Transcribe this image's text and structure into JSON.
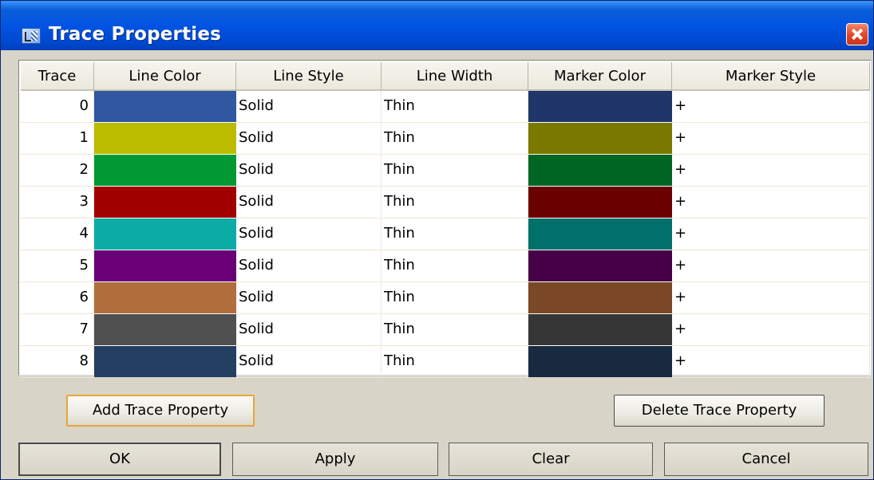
{
  "window": {
    "title": "Trace Properties"
  },
  "table": {
    "headers": [
      "Trace",
      "Line Color",
      "Line Style",
      "Line Width",
      "Marker Color",
      "Marker Style"
    ],
    "rows": [
      {
        "trace": "0",
        "line_color": "#3057a0",
        "line_style": "Solid",
        "line_width": "Thin",
        "marker_color": "#20366a",
        "marker_style": "+"
      },
      {
        "trace": "1",
        "line_color": "#bbbb00",
        "line_style": "Solid",
        "line_width": "Thin",
        "marker_color": "#7a7a00",
        "marker_style": "+"
      },
      {
        "trace": "2",
        "line_color": "#009933",
        "line_style": "Solid",
        "line_width": "Thin",
        "marker_color": "#006622",
        "marker_style": "+"
      },
      {
        "trace": "3",
        "line_color": "#a00000",
        "line_style": "Solid",
        "line_width": "Thin",
        "marker_color": "#6a0000",
        "marker_style": "+"
      },
      {
        "trace": "4",
        "line_color": "#0aaca5",
        "line_style": "Solid",
        "line_width": "Thin",
        "marker_color": "#00706b",
        "marker_style": "+"
      },
      {
        "trace": "5",
        "line_color": "#6a0077",
        "line_style": "Solid",
        "line_width": "Thin",
        "marker_color": "#470048",
        "marker_style": "+"
      },
      {
        "trace": "6",
        "line_color": "#b06e3c",
        "line_style": "Solid",
        "line_width": "Thin",
        "marker_color": "#7a4824",
        "marker_style": "+"
      },
      {
        "trace": "7",
        "line_color": "#505050",
        "line_style": "Solid",
        "line_width": "Thin",
        "marker_color": "#363636",
        "marker_style": "+"
      },
      {
        "trace": "8",
        "line_color": "#233f62",
        "line_style": "Solid",
        "line_width": "Thin",
        "marker_color": "#172a3f",
        "marker_style": "+"
      }
    ]
  },
  "buttons": {
    "add": "Add Trace Property",
    "delete": "Delete Trace Property",
    "ok": "OK",
    "apply": "Apply",
    "clear": "Clear",
    "cancel": "Cancel"
  }
}
